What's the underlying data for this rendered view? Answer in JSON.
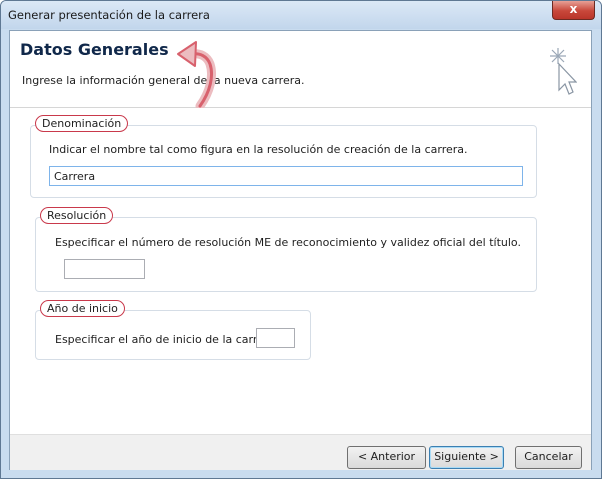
{
  "window": {
    "title": "Generar presentación de la carrera",
    "close_glyph": "x"
  },
  "header": {
    "title": "Datos Generales",
    "subtitle": "Ingrese la información general de la nueva carrera.",
    "icon": "wizard-wand-icon"
  },
  "groups": {
    "denominacion": {
      "legend": "Denominación",
      "description": "Indicar el nombre tal como figura en la resolución de creación de la carrera.",
      "value": "Carrera"
    },
    "resolucion": {
      "legend": "Resolución",
      "description": "Especificar el número de resolución ME de reconocimiento y validez oficial del título.",
      "value": ""
    },
    "anio_inicio": {
      "legend": "Año de inicio",
      "description": "Especificar el año de inicio de la carrera.",
      "value": ""
    }
  },
  "buttons": {
    "back": "< Anterior",
    "next": "Siguiente >",
    "cancel": "Cancelar"
  },
  "colors": {
    "annotation_red": "#c9394b",
    "window_frame": "#c9dcef",
    "close_button": "#c8473a"
  }
}
